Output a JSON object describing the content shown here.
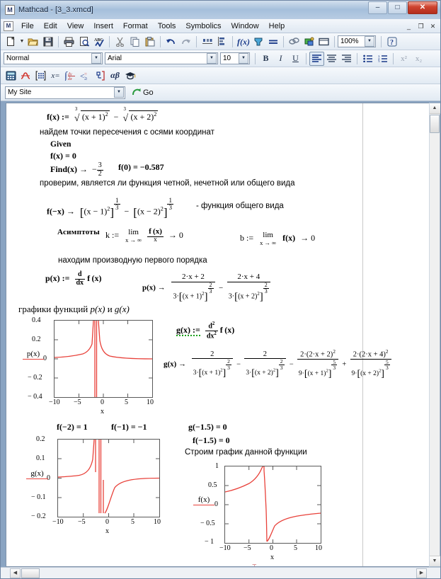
{
  "window": {
    "title": "Mathcad - [3_3.xmcd]",
    "icon": "mathcad-icon",
    "minimize": "–",
    "maximize": "□",
    "close": "✕"
  },
  "menubar": {
    "items": [
      "File",
      "Edit",
      "View",
      "Insert",
      "Format",
      "Tools",
      "Symbolics",
      "Window",
      "Help"
    ],
    "mdi_minimize": "_",
    "mdi_restore": "❐",
    "mdi_close": "✕"
  },
  "standard_toolbar": {
    "buttons": [
      "new-icon",
      "new-dropdown-icon",
      "open-icon",
      "save-icon",
      "print-icon",
      "print-preview-icon",
      "spellcheck-icon",
      "cut-icon",
      "copy-icon",
      "paste-icon",
      "undo-icon",
      "redo-icon",
      "align-across-icon",
      "align-down-icon",
      "insert-function-icon",
      "insert-unit-icon",
      "calculate-icon",
      "insert-hyperlink-icon",
      "insert-component-icon",
      "insert-area-icon"
    ],
    "zoom_value": "100%",
    "help_icon": "help-icon"
  },
  "format_toolbar": {
    "style_value": "Normal",
    "font_value": "Arial",
    "size_value": "10",
    "bold": "B",
    "italic": "I",
    "underline": "U",
    "buttons": [
      "align-left-icon",
      "align-center-icon",
      "align-right-icon",
      "bullet-list-icon",
      "numbered-list-icon",
      "superscript-icon",
      "subscript-icon"
    ]
  },
  "math_toolbar": {
    "buttons": [
      "calculator-palette-icon",
      "graph-palette-icon",
      "matrix-palette-icon",
      "evaluation-palette-icon",
      "calculus-palette-icon",
      "boolean-palette-icon",
      "programming-palette-icon",
      "greek-palette-icon",
      "symbolic-palette-icon"
    ]
  },
  "web_toolbar": {
    "site_value": "My Site",
    "go_label": "Go",
    "go_icon": "go-arrow-icon"
  },
  "document": {
    "definition_label": "f(x) :=",
    "text_find_intersections": "найдем точки пересечения с осями координат",
    "given": "Given",
    "eq_fx0": "f(x) = 0",
    "find_label": "Find(x) →",
    "find_value_num": "3",
    "find_value_den": "2",
    "f0_result": "f(0) = −0.587",
    "text_parity": "проверим, является ли функция четной, нечетной или общего вида",
    "parity_lhs": "f(−x) →",
    "parity_note": "- функция общего вида",
    "asymptotes_label": "Асимптоты",
    "k_def": "k :=",
    "lim_word": "lim",
    "lim_sub": "x → ∞",
    "k_result": "→ 0",
    "b_def": "b :=",
    "b_body": "f(x)",
    "b_result": "→ 0",
    "text_first_derivative": "находим производную первого порядка",
    "p_def": "p(x) :=",
    "p_arrow": "p(x) →",
    "text_graphs_pg": "графики функций p(x) и g(x)",
    "g_def": "g(x) :=",
    "g_arrow": "g(x) →",
    "f_minus2": "f(−2) = 1",
    "f_minus1": "f(−1) = −1",
    "g_minus15": "g(−1.5) = 0",
    "f_minus15": "f(−1.5) = 0",
    "text_build_plot": "Строим график данной функции",
    "d_dx": "d",
    "dx": "dx"
  },
  "chart_data": [
    {
      "type": "line",
      "name": "plot-p",
      "ylabel": "p(x)",
      "xlabel": "x",
      "xlim": [
        -10,
        10
      ],
      "ylim": [
        -0.4,
        0.4
      ],
      "xticks": [
        "−10",
        "−5",
        "0",
        "5",
        "10"
      ],
      "yticks": [
        "0.4",
        "0.2",
        "0",
        "− 0.2",
        "− 0.4"
      ],
      "grid": false,
      "color": "#e8413a",
      "description": "first derivative p(x), vertical asymptotes at x=-2 and x=-1"
    },
    {
      "type": "line",
      "name": "plot-g",
      "ylabel": "g(x)",
      "xlabel": "x",
      "xlim": [
        -10,
        10
      ],
      "ylim": [
        -0.2,
        0.2
      ],
      "xticks": [
        "−10",
        "−5",
        "0",
        "5",
        "10"
      ],
      "yticks": [
        "0.2",
        "0.1",
        "0",
        "− 0.1",
        "− 0.2"
      ],
      "grid": false,
      "color": "#e8413a",
      "description": "second derivative g(x), vertical asymptotes at x=-2 and x=-1"
    },
    {
      "type": "line",
      "name": "plot-f",
      "ylabel": "f(x)",
      "xlabel": "x",
      "xlim": [
        -10,
        10
      ],
      "ylim": [
        -1,
        1
      ],
      "xticks": [
        "−10",
        "−5",
        "0",
        "5",
        "10"
      ],
      "yticks": [
        "1",
        "0.5",
        "0",
        "− 0.5",
        "− 1"
      ],
      "grid": false,
      "color": "#e8413a",
      "description": "function f(x) = cbrt((x+1)^2) - cbrt((x+2)^2)"
    }
  ]
}
